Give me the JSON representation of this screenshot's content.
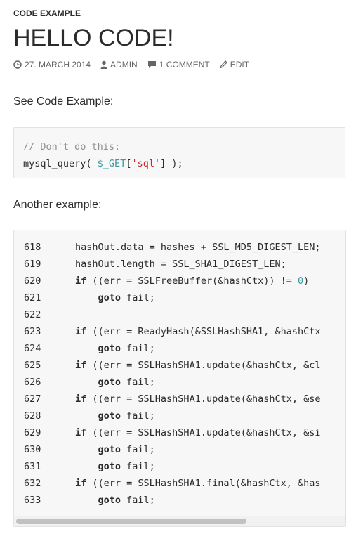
{
  "post": {
    "category": "CODE EXAMPLE",
    "title": "HELLO CODE!",
    "meta": {
      "date": "27. MARCH 2014",
      "author": "ADMIN",
      "comments": "1 COMMENT",
      "edit": "EDIT"
    },
    "para1": "See Code Example:",
    "para2": "Another example:"
  },
  "code1": {
    "line1": "// Don't do this:",
    "line2_a": "mysql_query( ",
    "line2_var": "$_GET",
    "line2_b": "[",
    "line2_str": "'sql'",
    "line2_c": "] );"
  },
  "code2": {
    "rows": [
      {
        "n": "618",
        "indent": "",
        "kw": "",
        "text": "hashOut.data = hashes + SSL_MD5_DIGEST_LEN;",
        "num": "",
        "tail": ""
      },
      {
        "n": "619",
        "indent": "",
        "kw": "",
        "text": "hashOut.length = SSL_SHA1_DIGEST_LEN;",
        "num": "",
        "tail": ""
      },
      {
        "n": "620",
        "indent": "",
        "kw": "if",
        "text": " ((err = SSLFreeBuffer(&hashCtx)) != ",
        "num": "0",
        "tail": ")"
      },
      {
        "n": "621",
        "indent": "    ",
        "kw": "goto",
        "text": " fail;",
        "num": "",
        "tail": ""
      },
      {
        "n": "622",
        "indent": "",
        "kw": "",
        "text": "",
        "num": "",
        "tail": ""
      },
      {
        "n": "623",
        "indent": "",
        "kw": "if",
        "text": " ((err = ReadyHash(&SSLHashSHA1, &hashCtx",
        "num": "",
        "tail": ""
      },
      {
        "n": "624",
        "indent": "    ",
        "kw": "goto",
        "text": " fail;",
        "num": "",
        "tail": ""
      },
      {
        "n": "625",
        "indent": "",
        "kw": "if",
        "text": " ((err = SSLHashSHA1.update(&hashCtx, &cl",
        "num": "",
        "tail": ""
      },
      {
        "n": "626",
        "indent": "    ",
        "kw": "goto",
        "text": " fail;",
        "num": "",
        "tail": ""
      },
      {
        "n": "627",
        "indent": "",
        "kw": "if",
        "text": " ((err = SSLHashSHA1.update(&hashCtx, &se",
        "num": "",
        "tail": ""
      },
      {
        "n": "628",
        "indent": "    ",
        "kw": "goto",
        "text": " fail;",
        "num": "",
        "tail": ""
      },
      {
        "n": "629",
        "indent": "",
        "kw": "if",
        "text": " ((err = SSLHashSHA1.update(&hashCtx, &si",
        "num": "",
        "tail": ""
      },
      {
        "n": "630",
        "indent": "    ",
        "kw": "goto",
        "text": " fail;",
        "num": "",
        "tail": ""
      },
      {
        "n": "631",
        "indent": "    ",
        "kw": "goto",
        "text": " fail;",
        "num": "",
        "tail": ""
      },
      {
        "n": "632",
        "indent": "",
        "kw": "if",
        "text": " ((err = SSLHashSHA1.final(&hashCtx, &has",
        "num": "",
        "tail": ""
      },
      {
        "n": "633",
        "indent": "    ",
        "kw": "goto",
        "text": " fail;",
        "num": "",
        "tail": ""
      }
    ]
  },
  "icons": {
    "date": "clock-icon",
    "author": "user-icon",
    "comments": "comment-icon",
    "edit": "pencil-icon"
  }
}
